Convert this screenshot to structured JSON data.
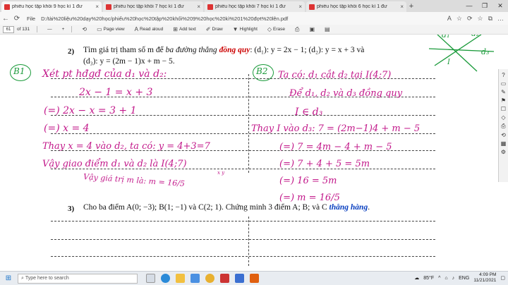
{
  "tabs": [
    {
      "title": "phiếu học tập khối 9 học kì 1 đư",
      "close": "×"
    },
    {
      "title": "phiếu học tập khối 7 học kì 1 đư",
      "close": "×"
    },
    {
      "title": "phiếu học tập khối 7 học kì 1 đư",
      "close": "×"
    },
    {
      "title": "phiếu học tập khối 6 học kì 1 đư",
      "close": "×"
    }
  ],
  "new_tab": "+",
  "window": {
    "minimize": "—",
    "maximize": "❐",
    "close": "✕"
  },
  "address": {
    "chip": "File",
    "url": "D:/tài%20liệu%20dạy%20học/phiếu%20học%20tập%20khối%209%20học%20kì%201%20đợt%20lên.pdf",
    "icons": [
      "A",
      "☆",
      "⟳",
      "☆",
      "⧉",
      "…"
    ]
  },
  "pdf_toolbar": {
    "page": "61",
    "of": "of 131",
    "zoom_out": "—",
    "zoom_in": "+",
    "page_view": "Page view",
    "read_aloud": "Read aloud",
    "add_text": "Add text",
    "draw": "Draw",
    "highlight": "Highlight",
    "erase": "Erase"
  },
  "question2": {
    "num": "2)",
    "line1_a": "Tìm giá trị tham số m để ",
    "line1_b": "ba đường thẳng ",
    "line1_c": "đồng quy",
    "line1_d": ": (d₁): y = 2x − 1; (d₂): y = x + 3 và",
    "line2": "(d₃): y = (2m − 1)x + m − 5."
  },
  "question3": {
    "num": "3)",
    "text_a": "Cho ba điểm A(0; −3); B(1; −1) và C(2; 1). Chứng minh 3 điểm A; B; và C ",
    "text_b": "thẳng hàng",
    "text_c": "."
  },
  "handwriting": {
    "b1": "B1",
    "b2": "B2",
    "d1": "d₁",
    "d2": "d₂",
    "d3": "d₃",
    "I": "I",
    "l1": "Xét pt hđgđ của d₁ và d₂:",
    "l2": "2x − 1 = x + 3",
    "l3": "(=) 2x − x = 3 + 1",
    "l4": "(=)   x  =  4",
    "l5": "Thay x = 4 vào d₂, ta có: y = 4+3=7",
    "l6": "Vậy giao điểm d₁ và d₂ là I(4;7)",
    "l6b": "x  y",
    "l7": "Vậy giá trị m là: m = 16/5",
    "r1": "Ta có: d₁ cắt d₂ tại I(4;7)",
    "r2": "Để d₁, d₂ và d₃ đồng quy",
    "r3": "I ∈ d₃",
    "r4": "Thay I vào d₃: 7 = (2m−1)4 + m − 5",
    "r5": "(=) 7 = 4m − 4 + m − 5",
    "r6": "(=) 7 + 4 + 5 = 5m",
    "r7": "(=)  16  =  5m",
    "r8": "(=)   m  =  16/5"
  },
  "sidebar_icons": [
    "?",
    "▭",
    "✎",
    "⚑",
    "☐",
    "◇",
    "⎙",
    "⟲",
    "▦",
    "⚙"
  ],
  "taskbar": {
    "search_placeholder": "Type here to search",
    "weather": "85°F",
    "lang": "ENG",
    "time": "4:09 PM",
    "date": "11/21/2021",
    "notify": "▢"
  }
}
